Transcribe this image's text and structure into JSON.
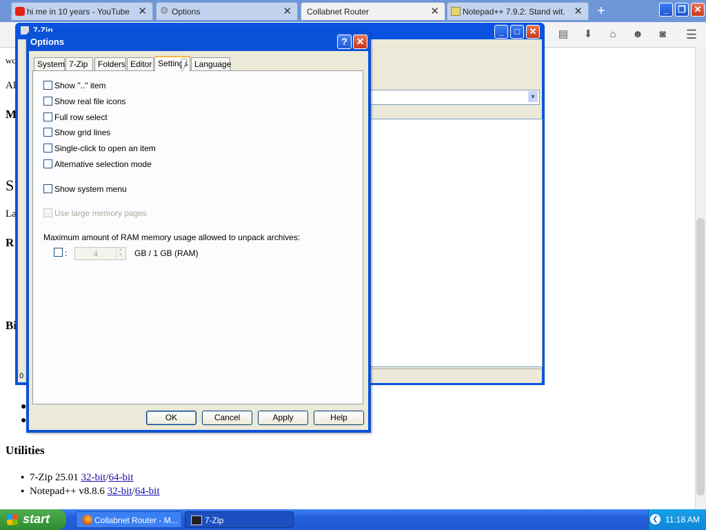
{
  "browser": {
    "tabs": [
      {
        "title": "hi me in 10 years - YouTube",
        "icon": "youtube-icon"
      },
      {
        "title": "Options",
        "icon": "gear-icon"
      },
      {
        "title": "Collabnet Router",
        "icon": ""
      },
      {
        "title": "Notepad++ 7.9.2: Stand wit...",
        "icon": "notepad-icon"
      }
    ],
    "new_tab": "+"
  },
  "page": {
    "fragments": [
      "wc",
      "Al",
      "M",
      "S",
      "La",
      "R",
      "Bi"
    ],
    "utilities_heading": "Utilities",
    "items": [
      {
        "name": "7-Zip 25.01 ",
        "link1": "32-bit",
        "sep": "/",
        "link2": "64-bit"
      },
      {
        "name": "Notepad++ v8.8.6 ",
        "link1": "32-bit",
        "sep": "/",
        "link2": "64-bit"
      }
    ]
  },
  "zip_window": {
    "title": "7-Zip",
    "status": "0"
  },
  "dialog": {
    "title": "Options",
    "tabs": [
      "System",
      "7-Zip",
      "Folders",
      "Editor",
      "Settings",
      "Language"
    ],
    "active_tab": "Settings",
    "settings": {
      "show_dotdot": "Show \"..\" item",
      "real_icons": "Show real file icons",
      "full_row": "Full row select",
      "grid_lines": "Show grid lines",
      "single_click": "Single-click to open an item",
      "alt_selection": "Alternative selection mode",
      "system_menu": "Show system menu",
      "large_pages": "Use large memory pages",
      "ram_label": "Maximum amount of RAM memory usage allowed to unpack archives:",
      "ram_colon": ":",
      "ram_value": "4",
      "ram_unit": "GB / 1 GB (RAM)"
    },
    "buttons": {
      "ok": "OK",
      "cancel": "Cancel",
      "apply": "Apply",
      "help": "Help"
    }
  },
  "taskbar": {
    "start": "start",
    "tasks": [
      {
        "label": "Collabnet Router - M..."
      },
      {
        "label": "7-Zip"
      }
    ],
    "clock": "11:18 AM"
  }
}
